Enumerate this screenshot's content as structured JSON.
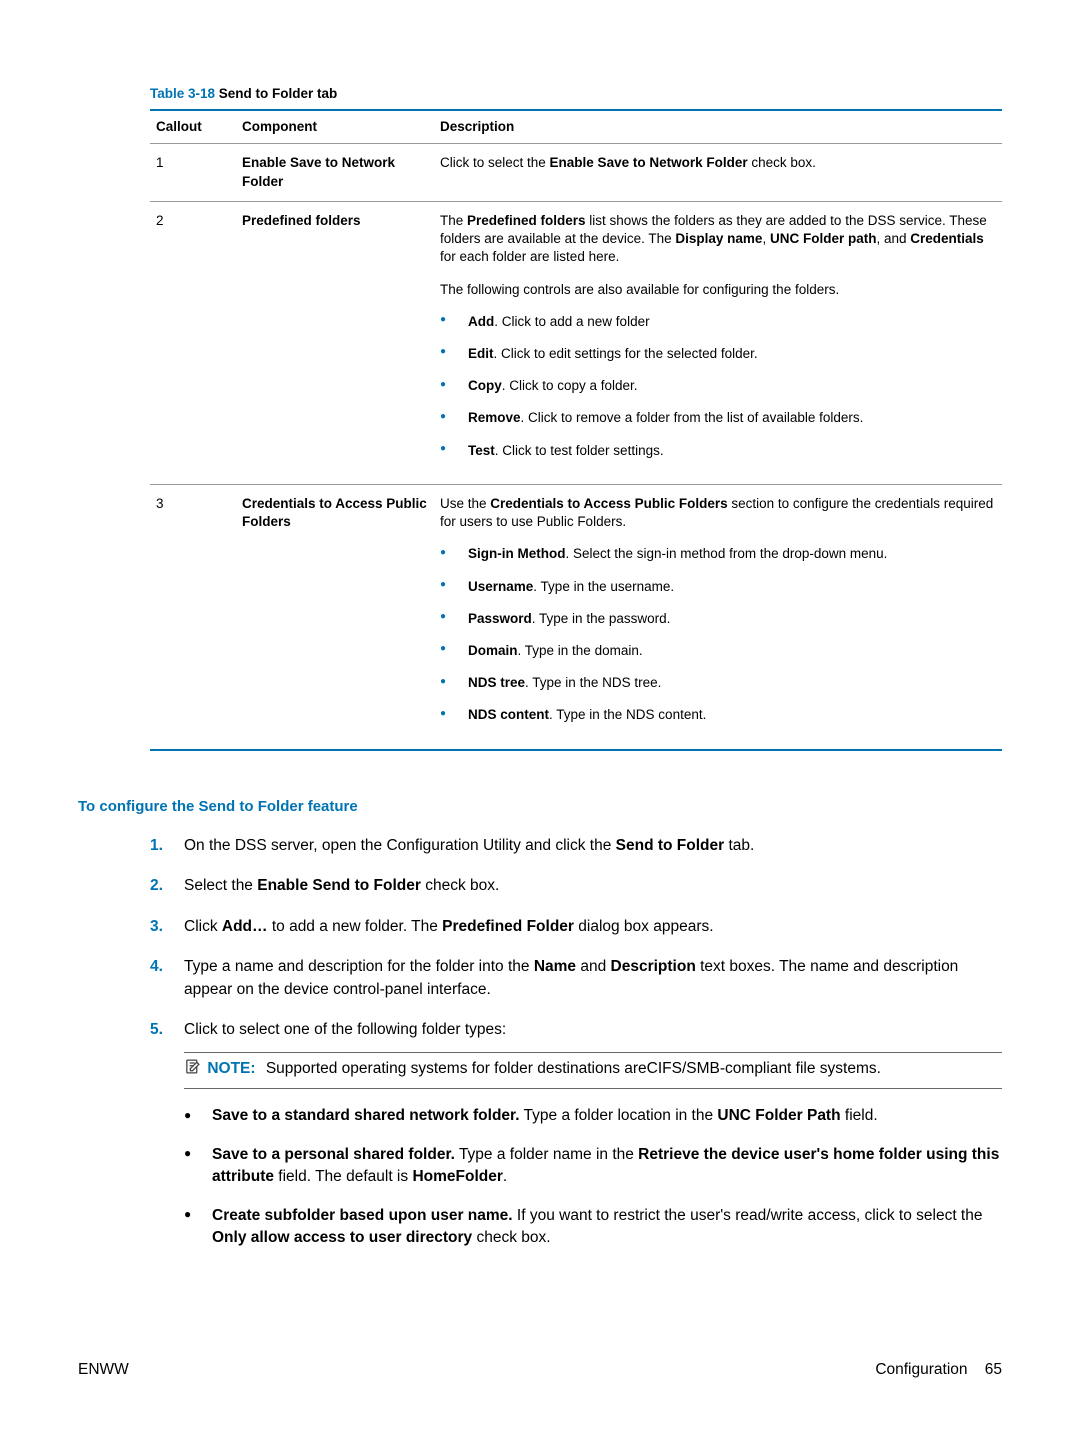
{
  "table_caption": {
    "number": "Table 3-18",
    "title": "  Send to Folder tab"
  },
  "columns": {
    "callout": "Callout",
    "component": "Component",
    "description": "Description"
  },
  "row1": {
    "callout": "1",
    "component": "Enable Save to Network Folder",
    "desc_pre": "Click to select the ",
    "desc_bold": "Enable Save to Network Folder",
    "desc_post": " check box."
  },
  "row2": {
    "callout": "2",
    "component": "Predefined folders",
    "p1_a": "The ",
    "p1_b": "Predefined folders",
    "p1_c": " list shows the folders as they are added to the DSS service. These folders are available at the device. The ",
    "p1_d": "Display name",
    "p1_e": ", ",
    "p1_f": "UNC Folder path",
    "p1_g": ", and ",
    "p1_h": "Credentials",
    "p1_i": " for each folder are listed here.",
    "p2": "The following controls are also available for configuring the folders.",
    "add_b": "Add",
    "add_t": ". Click to add a new folder",
    "edit_b": "Edit",
    "edit_t": ". Click to edit settings for the selected folder.",
    "copy_b": "Copy",
    "copy_t": ". Click to copy a folder.",
    "remove_b": "Remove",
    "remove_t": ". Click to remove a folder from the list of available folders.",
    "test_b": "Test",
    "test_t": ". Click to test folder settings."
  },
  "row3": {
    "callout": "3",
    "component": "Credentials to Access Public Folders",
    "p1_a": "Use the ",
    "p1_b": "Credentials to Access Public Folders",
    "p1_c": " section to configure the credentials required for users to use Public Folders.",
    "signin_b": "Sign-in Method",
    "signin_t": ". Select the sign-in method from the drop-down menu.",
    "user_b": "Username",
    "user_t": ". Type in the username.",
    "pass_b": "Password",
    "pass_t": ". Type in the password.",
    "dom_b": "Domain",
    "dom_t": ". Type in the domain.",
    "ndst_b": "NDS tree",
    "ndst_t": ". Type in the NDS tree.",
    "ndsc_b": "NDS content",
    "ndsc_t": ". Type in the NDS content."
  },
  "subhead": "To configure the Send to Folder feature",
  "steps": {
    "s1_a": "On the DSS server, open the Configuration Utility and click the ",
    "s1_b": "Send to Folder",
    "s1_c": " tab.",
    "s2_a": "Select the ",
    "s2_b": "Enable Send to Folder",
    "s2_c": " check box.",
    "s3_a": "Click ",
    "s3_b": "Add…",
    "s3_c": " to add a new folder. The ",
    "s3_d": "Predefined Folder",
    "s3_e": " dialog box appears.",
    "s4_a": "Type a name and description for the folder into the ",
    "s4_b": "Name",
    "s4_c": " and ",
    "s4_d": "Description",
    "s4_e": " text boxes. The name and description appear on the device control-panel interface.",
    "s5": "Click to select one of the following folder types:"
  },
  "note": {
    "label": "NOTE:",
    "text": "Supported operating systems for folder destinations areCIFS/SMB-compliant file systems."
  },
  "bullets": {
    "b1_a": "Save to a standard shared network folder.",
    "b1_b": " Type a folder location in the ",
    "b1_c": "UNC Folder Path",
    "b1_d": " field.",
    "b2_a": "Save to a personal shared folder.",
    "b2_b": " Type a folder name in the ",
    "b2_c": "Retrieve the device user's home folder using this attribute",
    "b2_d": " field. The default is ",
    "b2_e": "HomeFolder",
    "b2_f": ".",
    "b3_a": "Create subfolder based upon user name.",
    "b3_b": " If you want to restrict the user's read/write access, click to select the ",
    "b3_c": "Only allow access to user directory",
    "b3_d": " check box."
  },
  "footer": {
    "left": "ENWW",
    "right_label": "Configuration",
    "right_page": "65"
  }
}
